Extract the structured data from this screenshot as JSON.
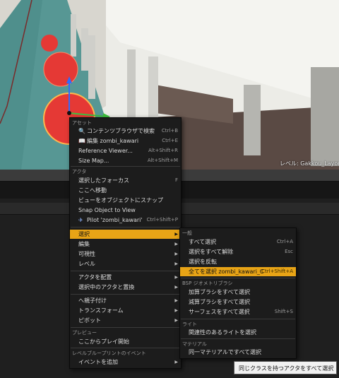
{
  "viewport": {
    "level_label": "レベル:  Gakkou_Layout"
  },
  "context_menu": {
    "sections": {
      "asset": "アセット",
      "actor": "アクタ",
      "preview": "プレビュー",
      "blueprint": "レベルブループリントのイベント"
    },
    "items": {
      "browse": {
        "label": "コンテンツブラウザで検索",
        "shortcut": "Ctrl+B",
        "icon": "folder-search-icon"
      },
      "edit": {
        "label": "編集 zombi_kawari",
        "shortcut": "Ctrl+E",
        "icon": "book-icon"
      },
      "reference_viewer": {
        "label": "Reference Viewer...",
        "shortcut": "Alt+Shift+R"
      },
      "size_map": {
        "label": "Size Map...",
        "shortcut": "Alt+Shift+M"
      },
      "focus": {
        "label": "選択したフォーカス",
        "shortcut": "F"
      },
      "move_here": {
        "label": "ここへ移動"
      },
      "snap_view": {
        "label": "ビューをオブジェクトにスナップ"
      },
      "snap_to_view": {
        "label": "Snap Object to View"
      },
      "pilot": {
        "label": "Pilot 'zombi_kawari'",
        "shortcut": "Ctrl+Shift+P",
        "icon": "airplane-icon"
      },
      "select": {
        "label": "選択"
      },
      "edit_sub": {
        "label": "編集"
      },
      "visibility": {
        "label": "可視性"
      },
      "level": {
        "label": "レベル"
      },
      "place_actor": {
        "label": "アクタを配置"
      },
      "replace_actor": {
        "label": "選択中のアクタと置換"
      },
      "attach": {
        "label": "へ親子付け"
      },
      "transform": {
        "label": "トランスフォーム"
      },
      "pivot": {
        "label": "ピボット"
      },
      "play_here": {
        "label": "ここからプレイ開始"
      },
      "add_event": {
        "label": "イベントを追加"
      }
    }
  },
  "select_submenu": {
    "sections": {
      "general": "一般",
      "bsp": "BSP ジオメトリブラシ",
      "light": "ライト",
      "material": "マテリアル"
    },
    "items": {
      "select_all": {
        "label": "すべて選択",
        "shortcut": "Ctrl+A"
      },
      "deselect_all": {
        "label": "選択をすべて解除",
        "shortcut": "Esc"
      },
      "invert": {
        "label": "選択を反転"
      },
      "select_class": {
        "label": "全てを選択 zombi_kawari_C",
        "shortcut": "Ctrl+Shift+A"
      },
      "additive_brushes": {
        "label": "加算ブラシをすべて選択"
      },
      "subtractive_brushes": {
        "label": "減算ブラシをすべて選択"
      },
      "surfaces": {
        "label": "サーフェスをすべて選択",
        "shortcut": "Shift+S"
      },
      "relevant_lights": {
        "label": "関連性のあるライトを選択"
      },
      "same_material": {
        "label": "同一マテリアルですべて選択"
      }
    }
  },
  "tooltip": {
    "text": "同じクラスを持つアクタをすべて選択"
  },
  "colors": {
    "highlight": "#e8a416",
    "menu_bg": "#1c1c1c",
    "floor": "#4f8f8c",
    "sphere": "#e53935"
  }
}
